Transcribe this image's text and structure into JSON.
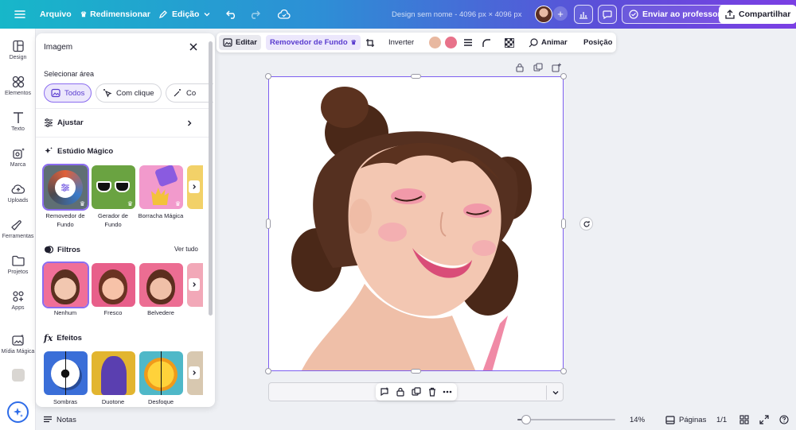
{
  "topbar": {
    "menu_icon": "hamburger-icon",
    "file": "Arquivo",
    "resize": "Redimensionar",
    "edit": "Edição",
    "design_title": "Design sem nome - 4096 px × 4096 px",
    "send_teacher": "Enviar ao professor",
    "share": "Compartilhar"
  },
  "rail": {
    "items": [
      {
        "label": "Design",
        "icon": "layout-icon"
      },
      {
        "label": "Elementos",
        "icon": "shapes-icon"
      },
      {
        "label": "Texto",
        "icon": "text-icon"
      },
      {
        "label": "Marca",
        "icon": "brand-icon"
      },
      {
        "label": "Uploads",
        "icon": "cloud-upload-icon"
      },
      {
        "label": "Ferramentas",
        "icon": "tools-icon"
      },
      {
        "label": "Projetos",
        "icon": "folder-icon"
      },
      {
        "label": "Apps",
        "icon": "apps-icon"
      },
      {
        "label": "Mídia Mágica",
        "icon": "magic-media-icon"
      }
    ]
  },
  "panel": {
    "title": "Imagem",
    "select_area_label": "Selecionar área",
    "chips": [
      "Todos",
      "Com clique",
      "Co"
    ],
    "adjust": "Ajustar",
    "magic_studio": "Estúdio Mágico",
    "magic_tools": [
      {
        "label": "Removedor de Fundo"
      },
      {
        "label": "Gerador de Fundo"
      },
      {
        "label": "Borracha Mágica"
      }
    ],
    "filters": "Filtros",
    "see_all": "Ver tudo",
    "filter_items": [
      {
        "label": "Nenhum"
      },
      {
        "label": "Fresco"
      },
      {
        "label": "Belvedere"
      }
    ],
    "effects": "Efeitos",
    "effect_items": [
      {
        "label": "Sombras"
      },
      {
        "label": "Duotone"
      },
      {
        "label": "Desfoque"
      }
    ]
  },
  "toolbar": {
    "edit": "Editar",
    "bg_remover": "Removedor de Fundo",
    "invert": "Inverter",
    "animate": "Animar",
    "position": "Posição",
    "swatch_colors": [
      "#e8b8a0",
      "#e8728a"
    ]
  },
  "bottom": {
    "notes": "Notas",
    "zoom_percent": 14,
    "zoom": "14%",
    "pages": "Páginas",
    "page_count": "1/1"
  },
  "colors": {
    "accent": "#7d5ff0",
    "brand_gradient_start": "#17b7c9",
    "brand_gradient_end": "#7b3fe4"
  }
}
